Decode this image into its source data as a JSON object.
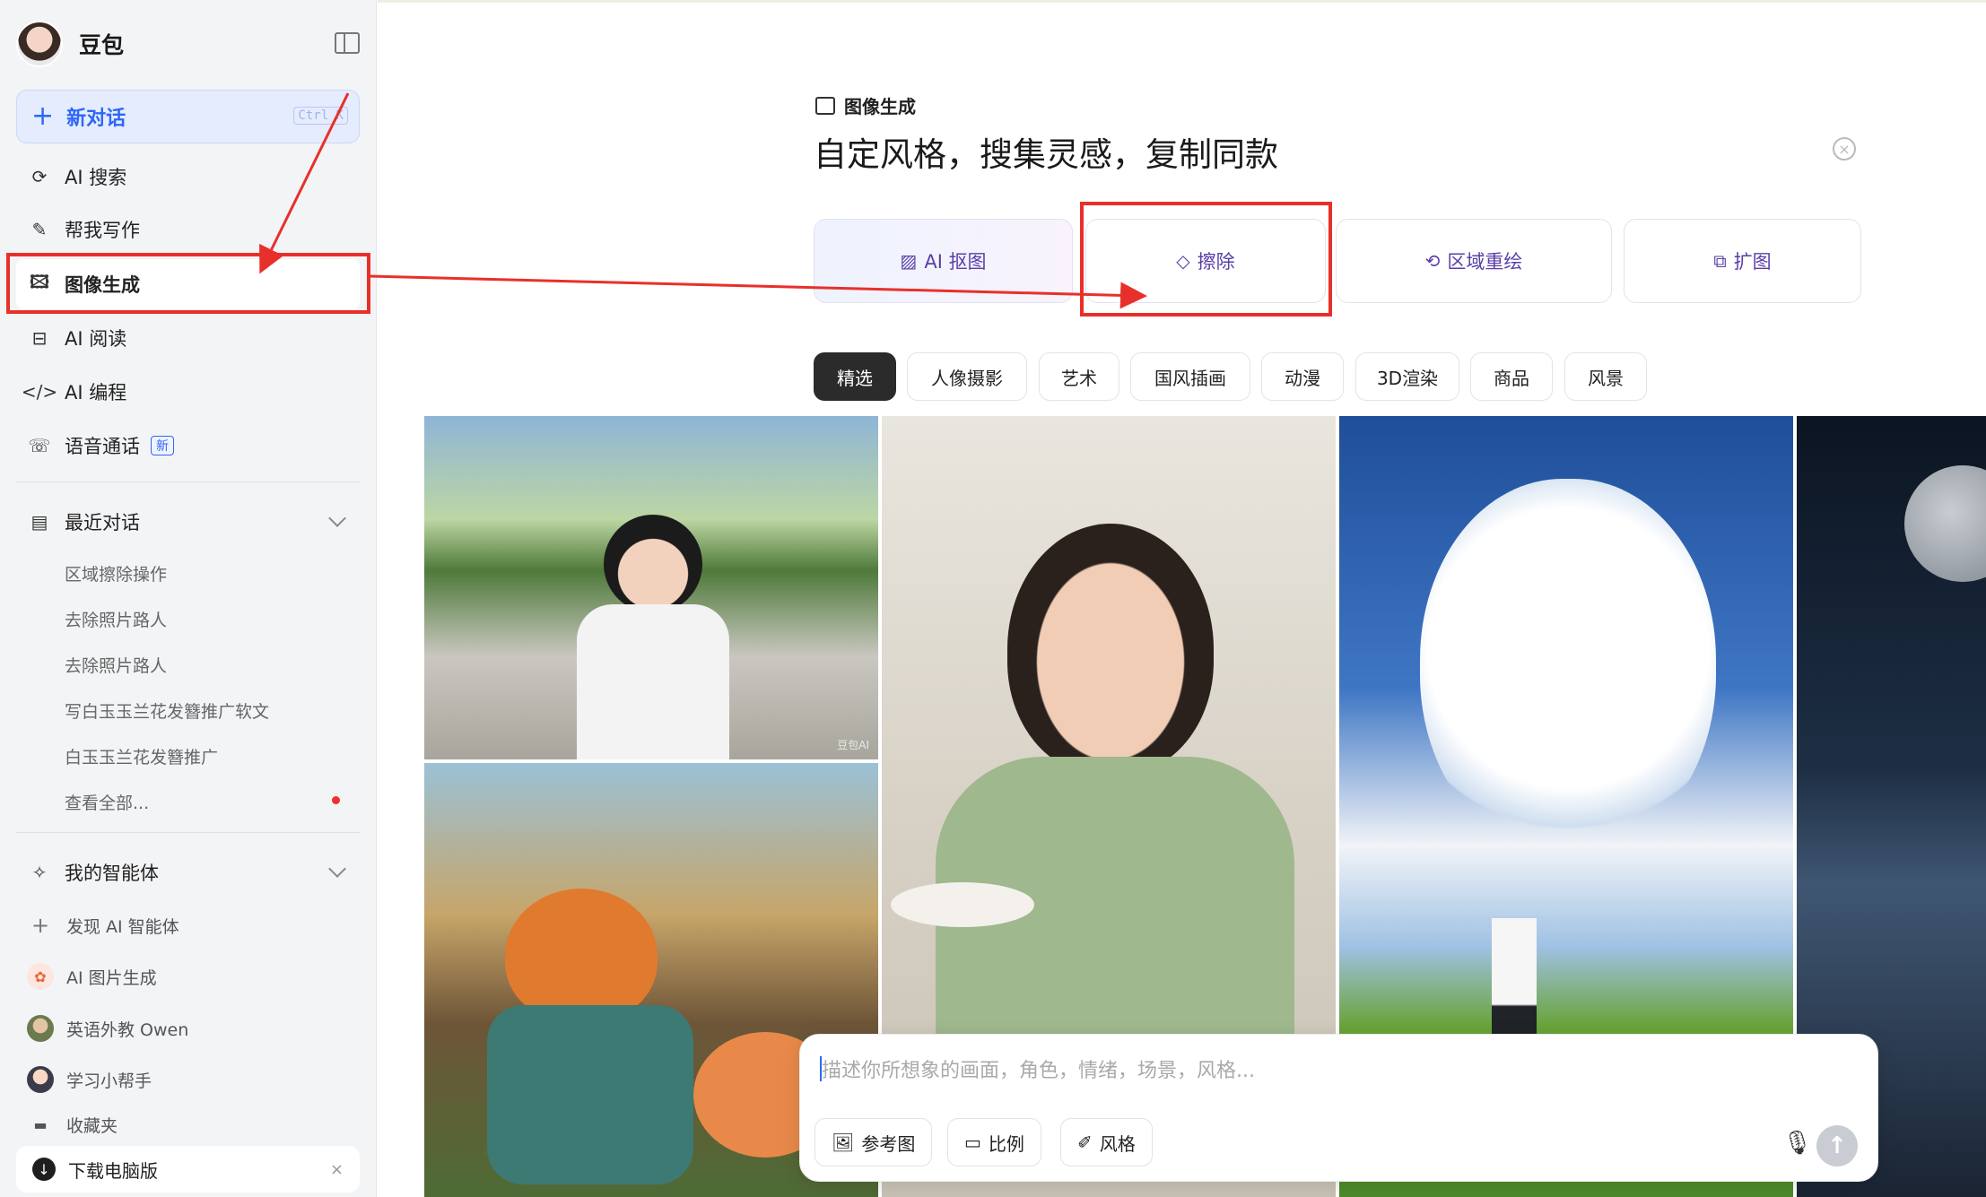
{
  "app": {
    "name": "豆包"
  },
  "sidebar": {
    "new_chat": {
      "label": "新对话",
      "shortcut": "Ctrl K"
    },
    "nav": [
      {
        "label": "AI 搜索",
        "icon": "search-refresh-icon"
      },
      {
        "label": "帮我写作",
        "icon": "pen-icon"
      },
      {
        "label": "图像生成",
        "icon": "image-gen-icon"
      },
      {
        "label": "AI 阅读",
        "icon": "book-icon"
      },
      {
        "label": "AI 编程",
        "icon": "code-icon"
      },
      {
        "label": "语音通话",
        "icon": "phone-icon",
        "badge": "新"
      }
    ],
    "recent": {
      "title": "最近对话",
      "items": [
        "区域擦除操作",
        "去除照片路人",
        "去除照片路人",
        "写白玉玉兰花发簪推广软文",
        "白玉玉兰花发簪推广",
        "查看全部..."
      ]
    },
    "agents": {
      "title": "我的智能体",
      "items": [
        {
          "label": "发现 AI 智能体",
          "icon": "plus-icon"
        },
        {
          "label": "AI 图片生成",
          "icon": "ai-image-icon"
        },
        {
          "label": "英语外教 Owen",
          "icon": "avatar-owen"
        },
        {
          "label": "学习小帮手",
          "icon": "avatar-helper"
        },
        {
          "label": "收藏夹",
          "icon": "bookmark-icon"
        }
      ]
    },
    "download": {
      "label": "下载电脑版",
      "close": "×"
    }
  },
  "main": {
    "mode_label": "图像生成",
    "headline": "自定风格，搜集灵感，复制同款",
    "tools": [
      {
        "label": "AI 抠图",
        "icon": "cutout-icon"
      },
      {
        "label": "擦除",
        "icon": "eraser-icon"
      },
      {
        "label": "区域重绘",
        "icon": "redraw-icon"
      },
      {
        "label": "扩图",
        "icon": "expand-icon"
      }
    ],
    "categories": [
      "精选",
      "人像摄影",
      "艺术",
      "国风插画",
      "动漫",
      "3D渲染",
      "商品",
      "风景"
    ],
    "active_category": "精选",
    "watermark": "豆包AI",
    "composer": {
      "placeholder": "描述你所想象的画面，角色，情绪，场景，风格...",
      "buttons": [
        {
          "label": "参考图",
          "icon": "image-ref-icon"
        },
        {
          "label": "比例",
          "icon": "ratio-icon"
        },
        {
          "label": "风格",
          "icon": "brush-icon"
        }
      ]
    }
  },
  "colors": {
    "accent": "#2f66f6",
    "annotation": "#e8302a",
    "tool_text": "#5a3ea8"
  }
}
